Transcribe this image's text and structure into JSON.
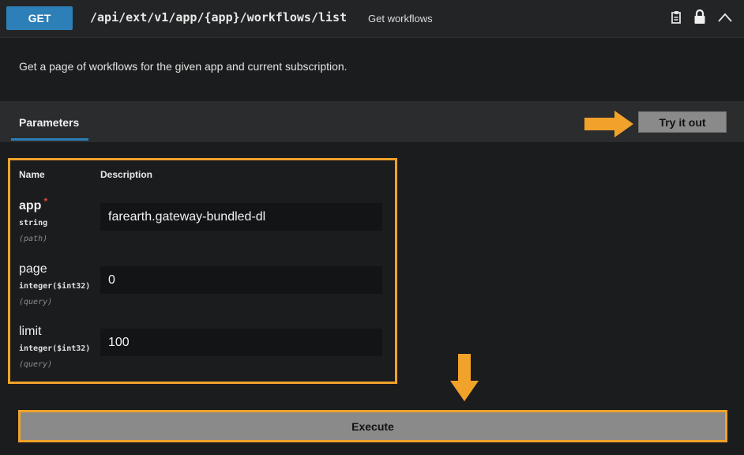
{
  "endpoint": {
    "method": "GET",
    "path": "/api/ext/v1/app/{app}/workflows/list",
    "summary": "Get workflows",
    "description": "Get a page of workflows for the given app and current subscription."
  },
  "icons": [
    "copy-icon",
    "lock-icon",
    "chevron-up-icon"
  ],
  "parameters": {
    "tab_label": "Parameters",
    "try_button_label": "Try it out",
    "columns": {
      "name": "Name",
      "description": "Description"
    },
    "items": [
      {
        "name": "app",
        "required_mark": "*",
        "type": "string",
        "in": "(path)",
        "value": "farearth.gateway-bundled-dl"
      },
      {
        "name": "page",
        "type": "integer($int32)",
        "in": "(query)",
        "value": "0"
      },
      {
        "name": "limit",
        "type": "integer($int32)",
        "in": "(query)",
        "value": "100"
      }
    ]
  },
  "execute_label": "Execute",
  "colors": {
    "method_bg": "#2d7fb7",
    "highlight": "#f0a22a",
    "required": "#e0463d",
    "button_bg": "#8a8a8a"
  }
}
